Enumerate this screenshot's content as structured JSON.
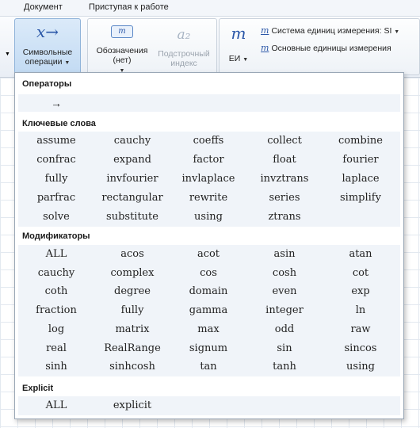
{
  "menu": {
    "tab1": "Документ",
    "tab2": "Приступая к работе"
  },
  "ribbon": {
    "symbolic": {
      "line1": "Символьные",
      "line2": "операции",
      "icon": "x→"
    },
    "labels": {
      "line1": "Обозначения",
      "line2": "(нет)",
      "icon": "m"
    },
    "subscript": {
      "line1": "Подстрочный",
      "line2": "индекс",
      "icon": "a₂"
    },
    "units": {
      "label": "ЕИ",
      "icon": "m"
    },
    "unit_system": "Система единиц измерения:  SI",
    "base_units": "Основные единицы измерения"
  },
  "popup": {
    "operators_title": "Операторы",
    "operator": "→",
    "keywords_title": "Ключевые слова",
    "keywords": [
      "assume",
      "cauchy",
      "coeffs",
      "collect",
      "combine",
      "confrac",
      "expand",
      "factor",
      "float",
      "fourier",
      "fully",
      "invfourier",
      "invlaplace",
      "invztrans",
      "laplace",
      "parfrac",
      "rectangular",
      "rewrite",
      "series",
      "simplify",
      "solve",
      "substitute",
      "using",
      "ztrans"
    ],
    "modifiers_title": "Модификаторы",
    "modifiers": [
      "ALL",
      "acos",
      "acot",
      "asin",
      "atan",
      "cauchy",
      "complex",
      "cos",
      "cosh",
      "cot",
      "coth",
      "degree",
      "domain",
      "even",
      "exp",
      "fraction",
      "fully",
      "gamma",
      "integer",
      "ln",
      "log",
      "matrix",
      "max",
      "odd",
      "raw",
      "real",
      "RealRange",
      "signum",
      "sin",
      "sincos",
      "sinh",
      "sinhcosh",
      "tan",
      "tanh",
      "using"
    ],
    "explicit_title": "Explicit",
    "explicit": [
      "ALL",
      "explicit"
    ]
  }
}
